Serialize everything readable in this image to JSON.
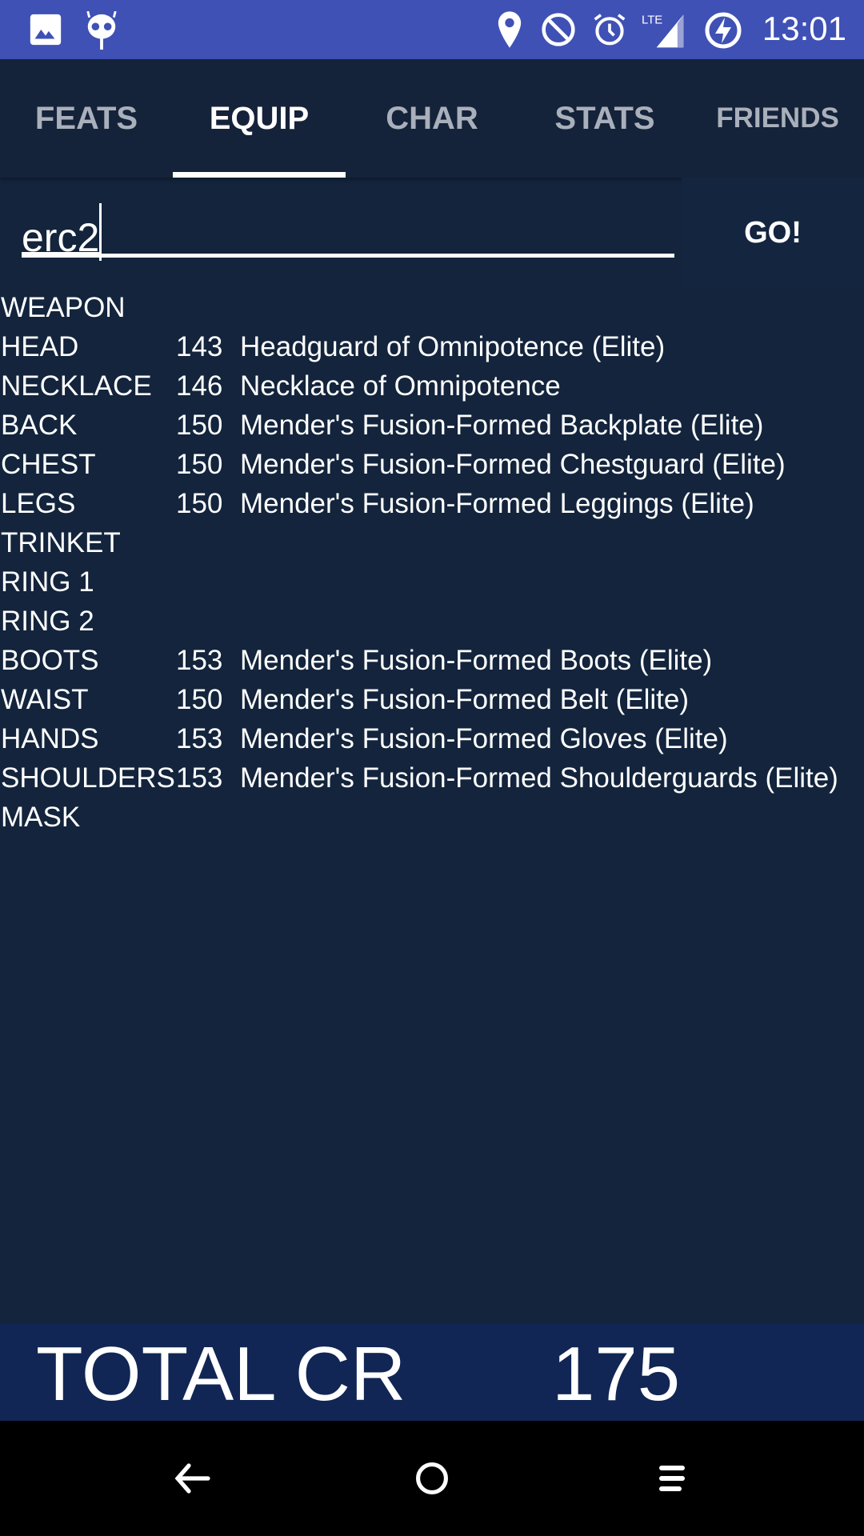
{
  "status_bar": {
    "time": "13:01",
    "left_icons": [
      "image-icon",
      "cyanogen-icon"
    ],
    "right_icons": [
      "location-icon",
      "do-not-disturb-icon",
      "alarm-icon",
      "lte-signal-icon",
      "battery-charging-icon"
    ],
    "network": "LTE",
    "color": "#3f51b5"
  },
  "tabs": [
    {
      "label": "FEATS",
      "active": false
    },
    {
      "label": "EQUIP",
      "active": true
    },
    {
      "label": "CHAR",
      "active": false
    },
    {
      "label": "STATS",
      "active": false
    },
    {
      "label": "FRIENDS",
      "active": false
    }
  ],
  "search": {
    "value": "erc2",
    "button": "GO!"
  },
  "equipment": [
    {
      "slot": "WEAPON",
      "level": "",
      "name": ""
    },
    {
      "slot": "HEAD",
      "level": "143",
      "name": "Headguard of Omnipotence (Elite)"
    },
    {
      "slot": "NECKLACE",
      "level": "146",
      "name": "Necklace of Omnipotence"
    },
    {
      "slot": "BACK",
      "level": "150",
      "name": "Mender's Fusion-Formed Backplate (Elite)"
    },
    {
      "slot": "CHEST",
      "level": "150",
      "name": "Mender's Fusion-Formed Chestguard (Elite)"
    },
    {
      "slot": "LEGS",
      "level": "150",
      "name": "Mender's Fusion-Formed Leggings (Elite)"
    },
    {
      "slot": "TRINKET",
      "level": "",
      "name": ""
    },
    {
      "slot": "RING 1",
      "level": "",
      "name": ""
    },
    {
      "slot": "RING 2",
      "level": "",
      "name": ""
    },
    {
      "slot": "BOOTS",
      "level": "153",
      "name": "Mender's Fusion-Formed Boots (Elite)"
    },
    {
      "slot": "WAIST",
      "level": "150",
      "name": "Mender's Fusion-Formed Belt (Elite)"
    },
    {
      "slot": "HANDS",
      "level": "153",
      "name": "Mender's Fusion-Formed Gloves (Elite)"
    },
    {
      "slot": "SHOULDERS",
      "level": "153",
      "name": "Mender's Fusion-Formed Shoulderguards (Elite)"
    },
    {
      "slot": "MASK",
      "level": "",
      "name": ""
    }
  ],
  "total": {
    "label": "TOTAL CR",
    "value": "175"
  },
  "nav_bar": [
    "back-icon",
    "home-icon",
    "menu-icon"
  ]
}
